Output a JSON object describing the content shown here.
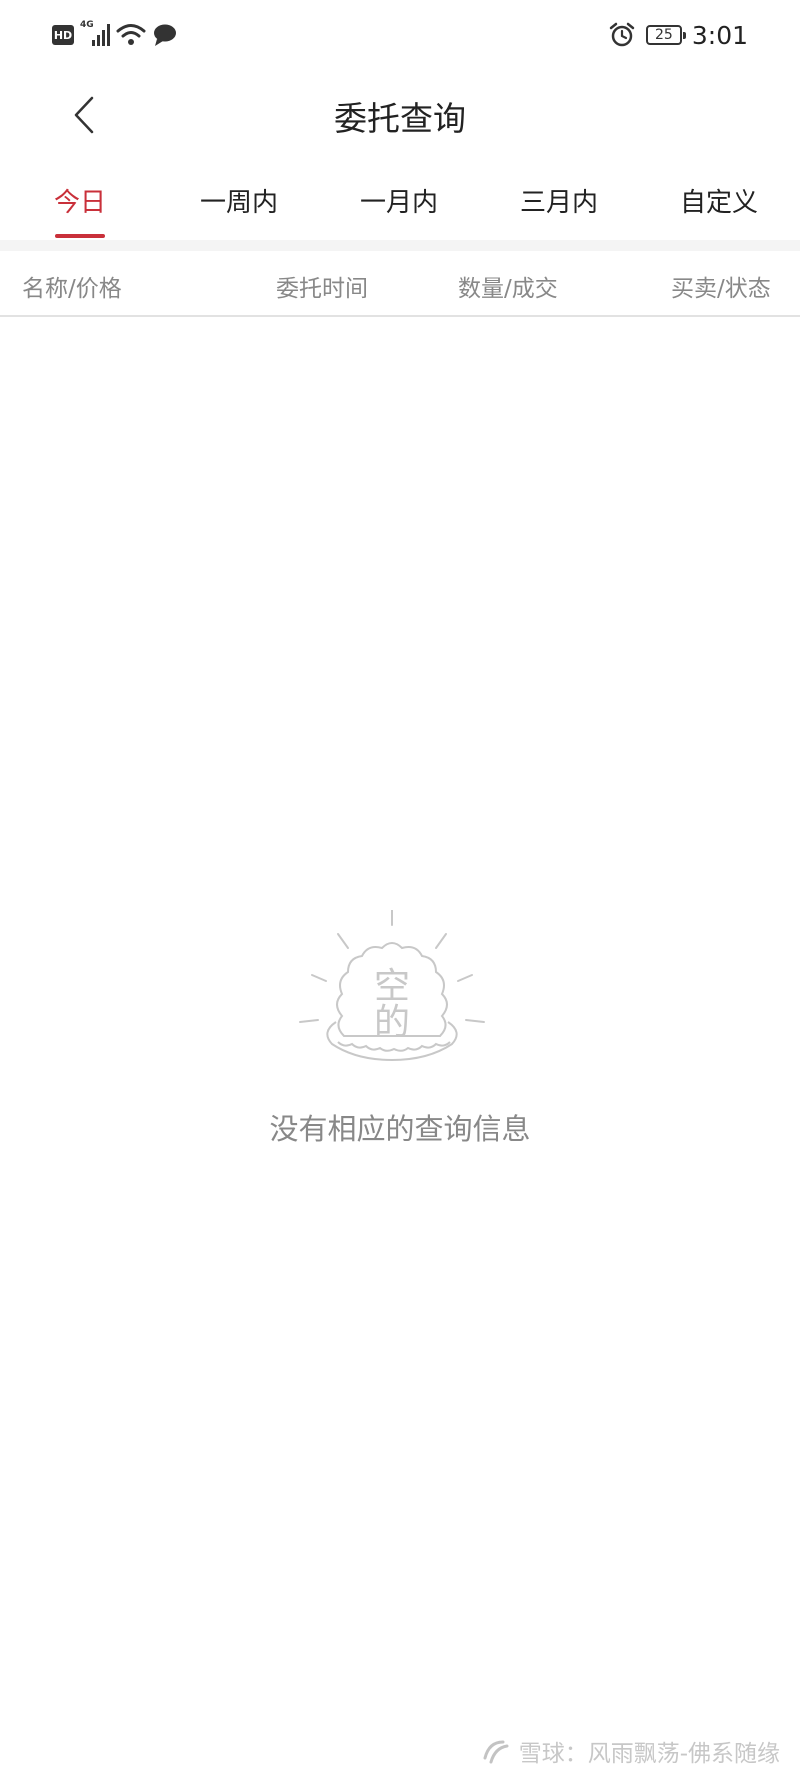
{
  "status_bar": {
    "hd_label": "HD",
    "network_label": "4G",
    "battery": "25",
    "time": "3:01",
    "icons": [
      "hd-icon",
      "signal-icon",
      "wifi-icon",
      "message-icon",
      "alarm-icon",
      "battery-icon"
    ]
  },
  "header": {
    "title": "委托查询",
    "back_icon": "chevron-left-icon"
  },
  "tabs": [
    {
      "label": "今日",
      "active": true
    },
    {
      "label": "一周内",
      "active": false
    },
    {
      "label": "一月内",
      "active": false
    },
    {
      "label": "三月内",
      "active": false
    },
    {
      "label": "自定义",
      "active": false
    }
  ],
  "columns": [
    "名称/价格",
    "委托时间",
    "数量/成交",
    "买卖/状态"
  ],
  "empty_state": {
    "illustration_text": [
      "空",
      "的"
    ],
    "message": "没有相应的查询信息"
  },
  "watermark": {
    "text": "雪球：风雨飘荡-佛系随缘"
  },
  "colors": {
    "accent": "#c9303a",
    "muted_text": "#888888",
    "divider": "#f4f4f4"
  }
}
